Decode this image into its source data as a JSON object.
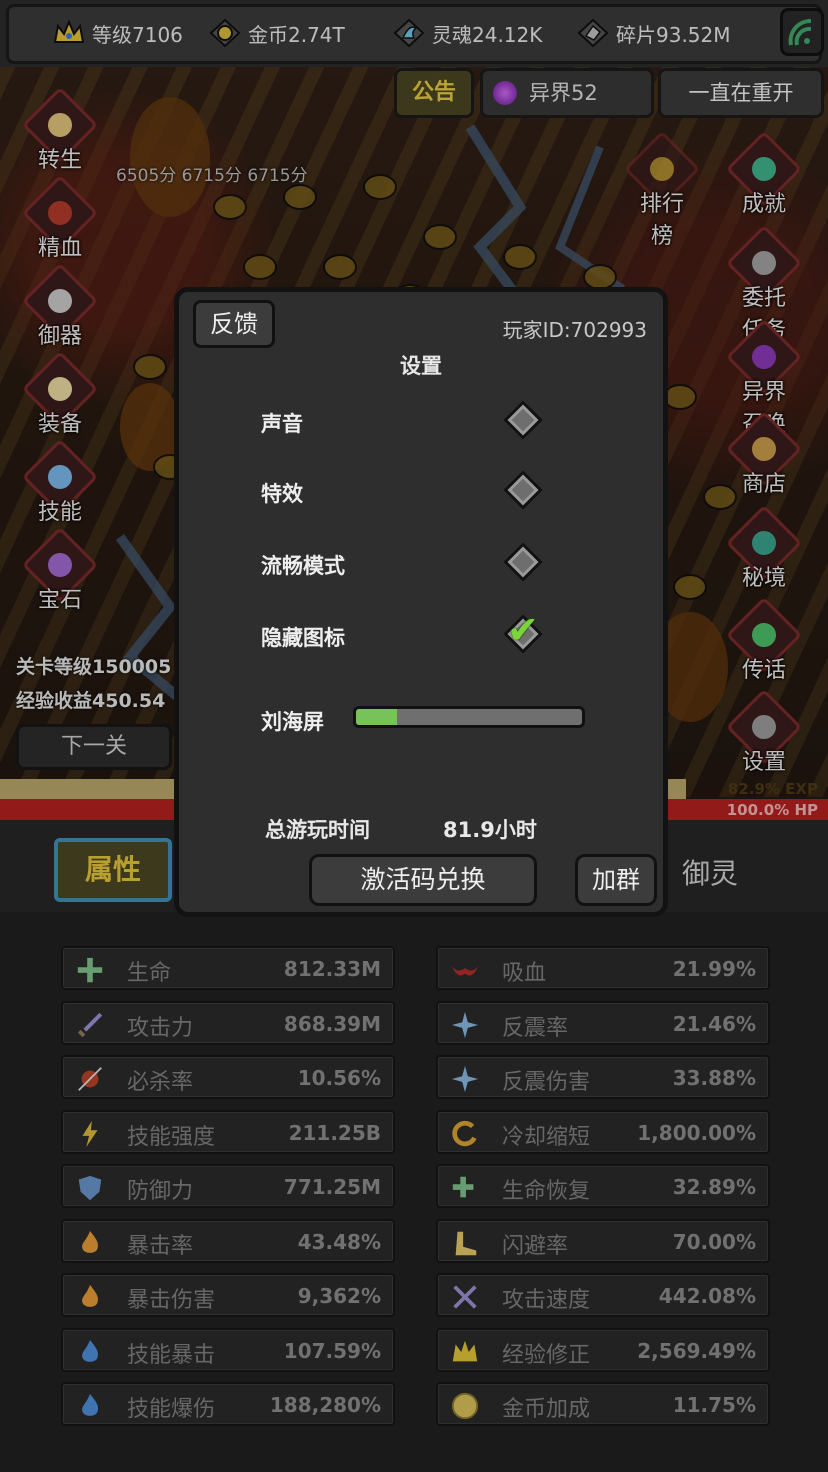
{
  "topbar": {
    "level": "等级7106",
    "gold": "金币2.74T",
    "soul": "灵魂24.12K",
    "shard": "碎片93.52M"
  },
  "header_tabs": {
    "notice": "公告",
    "otherworld": "异界52",
    "restart": "一直在重开"
  },
  "scores": "6505分 6715分 6715分",
  "left_menu": [
    "转生",
    "精血",
    "御器",
    "装备",
    "技能",
    "宝石"
  ],
  "right_menu": [
    "排行榜",
    "成就",
    "委托任务",
    "异界召唤",
    "商店",
    "秘境",
    "传话",
    "设置"
  ],
  "stage": {
    "level_text": "关卡等级150005",
    "exp_text": "经验收益450.54",
    "next_button": "下一关"
  },
  "bars": {
    "exp_text": "82.9% EXP",
    "hp_text": "100.0% HP",
    "exp_fill": 0.829,
    "hp_fill": 1.0
  },
  "tabs": {
    "attributes": "属性",
    "spirit": "御灵"
  },
  "stats_left": [
    {
      "name": "生命",
      "value": "812.33M",
      "icon": "plus-cross-icon"
    },
    {
      "name": "攻击力",
      "value": "868.39M",
      "icon": "sword-icon"
    },
    {
      "name": "必杀率",
      "value": "10.56%",
      "icon": "burst-icon"
    },
    {
      "name": "技能强度",
      "value": "211.25B",
      "icon": "lightning-icon"
    },
    {
      "name": "防御力",
      "value": "771.25M",
      "icon": "shield-icon"
    },
    {
      "name": "暴击率",
      "value": "43.48%",
      "icon": "flame-icon"
    },
    {
      "name": "暴击伤害",
      "value": "9,362%",
      "icon": "flame-icon"
    },
    {
      "name": "技能暴击",
      "value": "107.59%",
      "icon": "blue-flame-icon"
    },
    {
      "name": "技能爆伤",
      "value": "188,280%",
      "icon": "blue-flame-icon"
    }
  ],
  "stats_right": [
    {
      "name": "吸血",
      "value": "21.99%",
      "icon": "bat-icon"
    },
    {
      "name": "反震率",
      "value": "21.46%",
      "icon": "spark-icon"
    },
    {
      "name": "反震伤害",
      "value": "33.88%",
      "icon": "spark-icon"
    },
    {
      "name": "冷却缩短",
      "value": "1,800.00%",
      "icon": "cycle-icon"
    },
    {
      "name": "生命恢复",
      "value": "32.89%",
      "icon": "plus-arrow-icon"
    },
    {
      "name": "闪避率",
      "value": "70.00%",
      "icon": "boot-icon"
    },
    {
      "name": "攻击速度",
      "value": "442.08%",
      "icon": "crossed-swords-icon"
    },
    {
      "name": "经验修正",
      "value": "2,569.49%",
      "icon": "crown-icon"
    },
    {
      "name": "金币加成",
      "value": "11.75%",
      "icon": "coin-icon"
    }
  ],
  "settings": {
    "feedback": "反馈",
    "player_id": "玩家ID:702993",
    "title": "设置",
    "options": [
      {
        "label": "声音",
        "checked": false
      },
      {
        "label": "特效",
        "checked": false
      },
      {
        "label": "流畅模式",
        "checked": false
      },
      {
        "label": "隐藏图标",
        "checked": true
      }
    ],
    "notch_label": "刘海屏",
    "notch_value": 0.18,
    "playtime_label": "总游玩时间",
    "playtime_value": "81.9小时",
    "redeem_button": "激活码兑换",
    "join_group_button": "加群"
  },
  "colors": {
    "accent_gold": "#e2c23a",
    "check_green": "#7ad637",
    "hp_red": "#b3201f",
    "exp_tan": "#b8a66a",
    "tab_border_blue": "#3e8fb8"
  }
}
